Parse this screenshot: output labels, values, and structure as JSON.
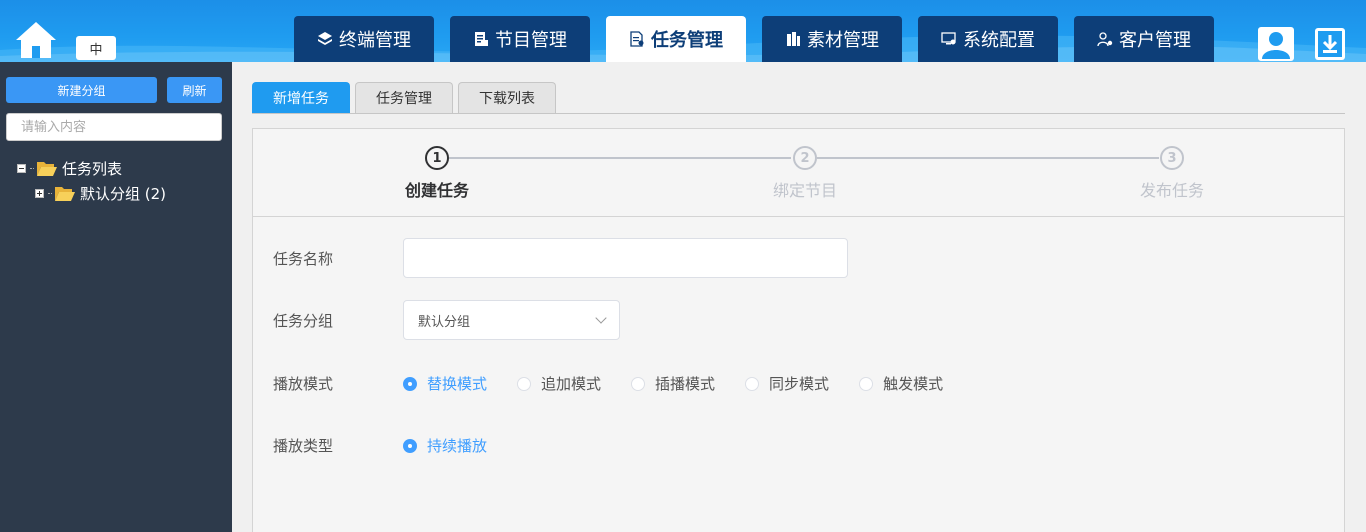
{
  "header": {
    "lang_label": "中",
    "nav": [
      {
        "label": "终端管理",
        "icon": "layers-icon"
      },
      {
        "label": "节目管理",
        "icon": "program-icon"
      },
      {
        "label": "任务管理",
        "icon": "task-doc-icon",
        "active": true
      },
      {
        "label": "素材管理",
        "icon": "material-icon"
      },
      {
        "label": "系统配置",
        "icon": "monitor-gear-icon"
      },
      {
        "label": "客户管理",
        "icon": "user-gear-icon"
      }
    ]
  },
  "sidebar": {
    "new_group_label": "新建分组",
    "refresh_label": "刷新",
    "search_placeholder": "请输入内容",
    "tree": {
      "root_label": "任务列表",
      "children": [
        {
          "label": "默认分组 (2)"
        }
      ]
    }
  },
  "main": {
    "tabs": [
      {
        "label": "新增任务",
        "active": true
      },
      {
        "label": "任务管理"
      },
      {
        "label": "下载列表"
      }
    ],
    "steps": [
      {
        "num": "1",
        "title": "创建任务",
        "active": true
      },
      {
        "num": "2",
        "title": "绑定节目"
      },
      {
        "num": "3",
        "title": "发布任务"
      }
    ],
    "form": {
      "task_name_label": "任务名称",
      "task_name_value": "",
      "task_group_label": "任务分组",
      "task_group_value": "默认分组",
      "play_mode_label": "播放模式",
      "play_modes": [
        {
          "label": "替换模式",
          "checked": true
        },
        {
          "label": "追加模式"
        },
        {
          "label": "插播模式"
        },
        {
          "label": "同步模式"
        },
        {
          "label": "触发模式"
        }
      ],
      "play_type_label": "播放类型",
      "play_types": [
        {
          "label": "持续播放",
          "checked": true
        }
      ]
    }
  },
  "colors": {
    "header_blue": "#1f9cf0",
    "nav_dark": "#0d3e78",
    "sidebar_bg": "#2d3a4b",
    "accent": "#409eff"
  }
}
